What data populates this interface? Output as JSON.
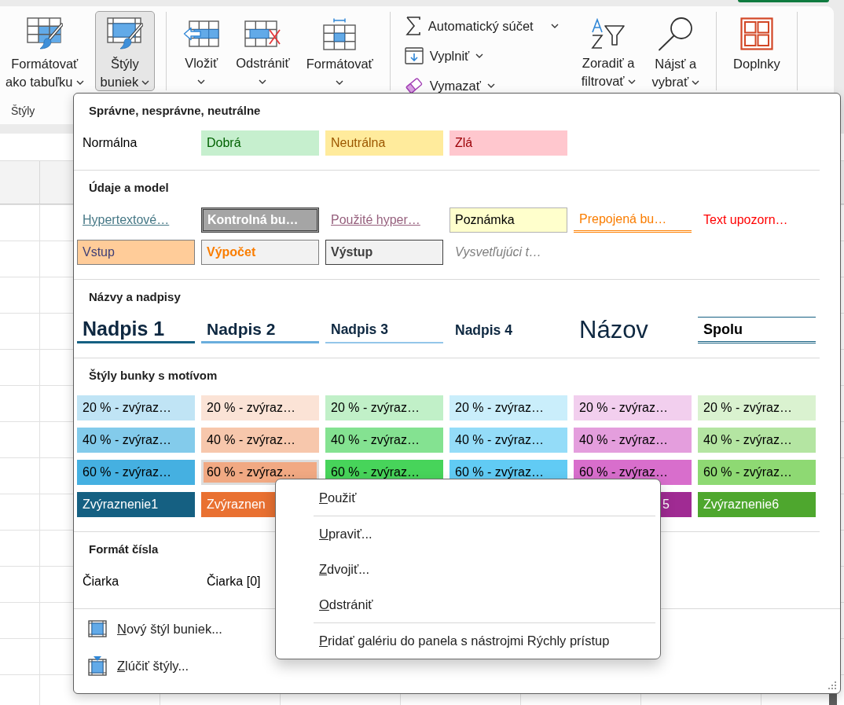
{
  "ribbon": {
    "groups": [
      {
        "label": "Štýly",
        "buttons": [
          {
            "kind": "format-table",
            "label": [
              "Formátovať",
              "ako tabuľku"
            ],
            "dropdown": true,
            "pressed": false
          },
          {
            "kind": "cell-styles",
            "label": [
              "Štýly",
              "buniek"
            ],
            "dropdown": true,
            "pressed": true
          }
        ]
      },
      {
        "buttons": [
          {
            "kind": "insert",
            "label": [
              "Vložiť"
            ],
            "dropdown": true,
            "pressed": false
          },
          {
            "kind": "delete",
            "label": [
              "Odstrániť"
            ],
            "dropdown": true,
            "pressed": false
          },
          {
            "kind": "format",
            "label": [
              "Formátovať"
            ],
            "dropdown": true,
            "pressed": false
          }
        ]
      },
      {
        "small_buttons": [
          {
            "kind": "autosum",
            "label": "Automatický súčet",
            "dropdown": true
          },
          {
            "kind": "fill",
            "label": "Vyplniť",
            "dropdown": true
          },
          {
            "kind": "clear",
            "label": "Vymazať",
            "dropdown": true
          }
        ],
        "buttons": [
          {
            "kind": "sort-filter",
            "label": [
              "Zoradiť a",
              "filtrovať"
            ],
            "dropdown": true,
            "pressed": false
          },
          {
            "kind": "find",
            "label": [
              "Nájsť a",
              "vybrať"
            ],
            "dropdown": true,
            "pressed": false
          }
        ]
      },
      {
        "buttons": [
          {
            "kind": "addins",
            "label": [
              "Doplnky"
            ],
            "dropdown": false,
            "pressed": false
          }
        ]
      }
    ]
  },
  "gallery": {
    "sections": [
      {
        "title": "Správne, nesprávne, neutrálne",
        "rows": [
          [
            {
              "kind": "normal",
              "text": "Normálna",
              "selected": false
            },
            {
              "kind": "good",
              "text": "Dobrá",
              "selected": false
            },
            {
              "kind": "neutral",
              "text": "Neutrálna",
              "selected": false
            },
            {
              "kind": "bad",
              "text": "Zlá",
              "selected": false
            }
          ]
        ]
      },
      {
        "title": "Údaje a model",
        "rows": [
          [
            {
              "kind": "link",
              "text": "Hypertextové…",
              "selected": false
            },
            {
              "kind": "check",
              "text": "Kontrolná bu…",
              "selected": false
            },
            {
              "kind": "visited",
              "text": "Použité hyper…",
              "selected": false
            },
            {
              "kind": "note",
              "text": "Poznámka",
              "selected": false
            },
            {
              "kind": "linked",
              "text": "Prepojená bu…",
              "selected": false
            },
            {
              "kind": "warning",
              "text": "Text upozorn…",
              "selected": false
            }
          ],
          [
            {
              "kind": "input",
              "text": "Vstup",
              "selected": false
            },
            {
              "kind": "calc",
              "text": "Výpočet",
              "selected": false
            },
            {
              "kind": "output",
              "text": "Výstup",
              "selected": false
            },
            {
              "kind": "explain",
              "text": "Vysvetľujúci t…",
              "selected": false
            }
          ]
        ]
      },
      {
        "title": "Názvy a nadpisy",
        "rows": [
          [
            {
              "kind": "h1",
              "text": "Nadpis 1",
              "selected": false
            },
            {
              "kind": "h2",
              "text": "Nadpis 2",
              "selected": false
            },
            {
              "kind": "h3",
              "text": "Nadpis 3",
              "selected": false
            },
            {
              "kind": "h4",
              "text": "Nadpis 4",
              "selected": false
            },
            {
              "kind": "title",
              "text": "Názov",
              "selected": false
            },
            {
              "kind": "total",
              "text": "Spolu",
              "selected": false
            }
          ]
        ]
      },
      {
        "title": "Štýly bunky s motívom",
        "rows": [
          [
            {
              "kind": "tint",
              "text": "20 % - zvýraz…",
              "color": "#c0e4f5",
              "selected": false
            },
            {
              "kind": "tint",
              "text": "20 % - zvýraz…",
              "color": "#fbe3d6",
              "selected": false
            },
            {
              "kind": "tint",
              "text": "20 % - zvýraz…",
              "color": "#c1f0c8",
              "selected": false
            },
            {
              "kind": "tint",
              "text": "20 % - zvýraz…",
              "color": "#caeefb",
              "selected": false
            },
            {
              "kind": "tint",
              "text": "20 % - zvýraz…",
              "color": "#f2cfee",
              "selected": false
            },
            {
              "kind": "tint",
              "text": "20 % - zvýraz…",
              "color": "#daf2d0",
              "selected": false
            }
          ],
          [
            {
              "kind": "tint",
              "text": "40 % - zvýraz…",
              "color": "#83cbeb",
              "selected": false
            },
            {
              "kind": "tint",
              "text": "40 % - zvýraz…",
              "color": "#f7c7ac",
              "selected": false
            },
            {
              "kind": "tint",
              "text": "40 % - zvýraz…",
              "color": "#84e291",
              "selected": false
            },
            {
              "kind": "tint",
              "text": "40 % - zvýraz…",
              "color": "#94dcf8",
              "selected": false
            },
            {
              "kind": "tint",
              "text": "40 % - zvýraz…",
              "color": "#e49edd",
              "selected": false
            },
            {
              "kind": "tint",
              "text": "40 % - zvýraz…",
              "color": "#b4e5a2",
              "selected": false
            }
          ],
          [
            {
              "kind": "tint",
              "text": "60 % - zvýraz…",
              "color": "#45b0e1",
              "selected": false
            },
            {
              "kind": "tint",
              "text": "60 % - zvýraz…",
              "color": "#f1a983",
              "selected": true
            },
            {
              "kind": "tint",
              "text": "60 % - zvýraz…",
              "color": "#47d45a",
              "selected": false
            },
            {
              "kind": "tint",
              "text": "60 % - zvýraz…",
              "color": "#61cbf4",
              "selected": false
            },
            {
              "kind": "tint",
              "text": "60 % - zvýraz…",
              "color": "#d86ecc",
              "selected": false
            },
            {
              "kind": "tint",
              "text": "60 % - zvýraz…",
              "color": "#8ed973",
              "selected": false
            }
          ],
          [
            {
              "kind": "accent",
              "text": "Zvýraznenie1",
              "color": "#156082",
              "selected": false
            },
            {
              "kind": "accent",
              "text": "Zvýraznen",
              "color": "#e97132",
              "selected": false
            },
            "",
            "",
            {
              "kind": "tail",
              "text": "5",
              "color": "#a02b93",
              "selected": false
            },
            {
              "kind": "accent",
              "text": "Zvýraznenie6",
              "color": "#4ea72e",
              "selected": false
            }
          ]
        ]
      },
      {
        "title": "Formát čísla",
        "rows": [
          [
            {
              "kind": "normal",
              "text": "Čiarka",
              "selected": false
            },
            {
              "kind": "normal",
              "text": "Čiarka [0]",
              "selected": false
            }
          ]
        ]
      }
    ],
    "commands": [
      {
        "kind": "new-style",
        "label": "Nový štýl buniek..."
      },
      {
        "kind": "merge-styles",
        "label": "Zlúčiť štýly..."
      }
    ]
  },
  "context_menu": {
    "items": [
      {
        "kind": "command",
        "label": "Použiť"
      },
      {
        "kind": "separator"
      },
      {
        "kind": "command",
        "label": "Upraviť..."
      },
      {
        "kind": "command",
        "label": "Zdvojiť..."
      },
      {
        "kind": "command",
        "label": "Odstrániť"
      },
      {
        "kind": "separator"
      },
      {
        "kind": "command",
        "label": "Pridať galériu do panela s nástrojmi Rýchly prístup"
      }
    ]
  }
}
